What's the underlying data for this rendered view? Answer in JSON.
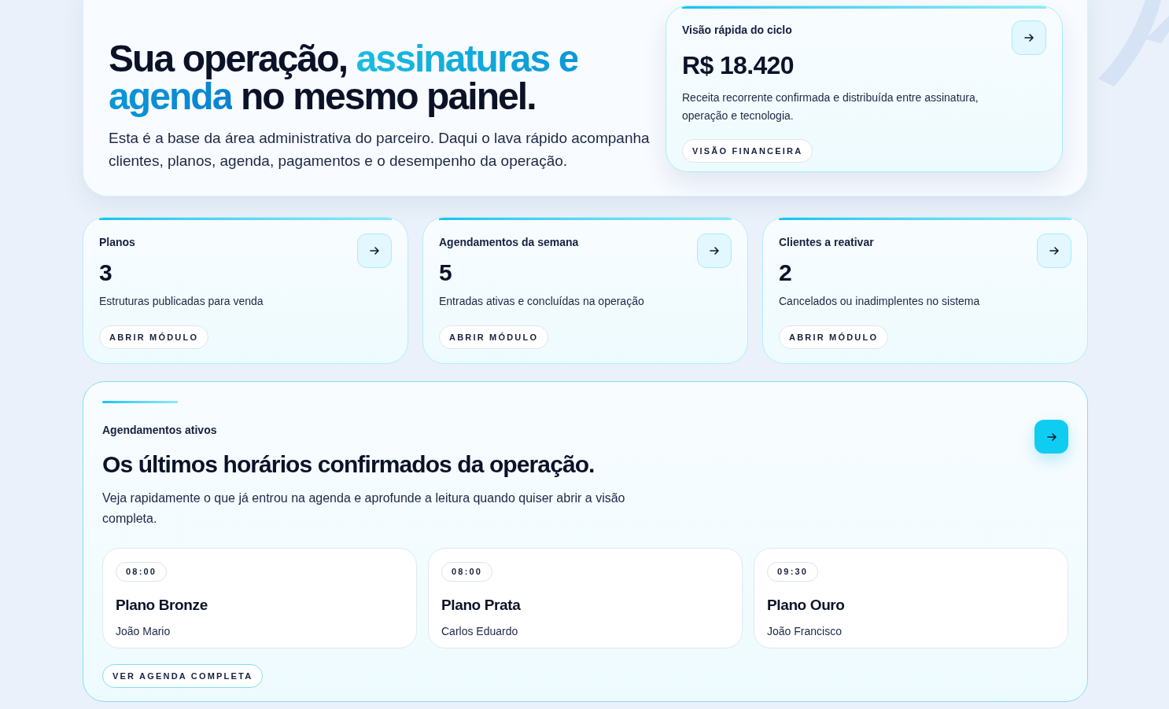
{
  "hero": {
    "title_parts": [
      {
        "text": "Sua operação, ",
        "highlight": false
      },
      {
        "text": "assinaturas e agenda",
        "highlight": true
      },
      {
        "text": " no mesmo painel.",
        "highlight": false
      }
    ],
    "description": "Esta é a base da área administrativa do parceiro. Daqui o lava rápido acompanha clientes, planos, agenda, pagamentos e o desempenho da operação.",
    "summary": {
      "label": "Visão rápida do ciclo",
      "value": "R$ 18.420",
      "description": "Receita recorrente confirmada e distribuída entre assinatura, operação e tecnologia.",
      "button": "VISÃO FINANCEIRA"
    }
  },
  "stats": [
    {
      "label": "Planos",
      "value": "3",
      "description": "Estruturas publicadas para venda",
      "button": "ABRIR MÓDULO"
    },
    {
      "label": "Agendamentos da semana",
      "value": "5",
      "description": "Entradas ativas e concluídas na operação",
      "button": "ABRIR MÓDULO"
    },
    {
      "label": "Clientes a reativar",
      "value": "2",
      "description": "Cancelados ou inadimplentes no sistema",
      "button": "ABRIR MÓDULO"
    }
  ],
  "appointments": {
    "eyebrow": "Agendamentos ativos",
    "title": "Os últimos horários confirmados da operação.",
    "description": "Veja rapidamente o que já entrou na agenda e aprofunde a leitura quando quiser abrir a visão completa.",
    "items": [
      {
        "time": "08:00",
        "plan": "Plano Bronze",
        "client": "João Mario"
      },
      {
        "time": "08:00",
        "plan": "Plano Prata",
        "client": "Carlos Eduardo"
      },
      {
        "time": "09:30",
        "plan": "Plano Ouro",
        "client": "João Francisco"
      }
    ],
    "button": "VER AGENDA COMPLETA"
  }
}
